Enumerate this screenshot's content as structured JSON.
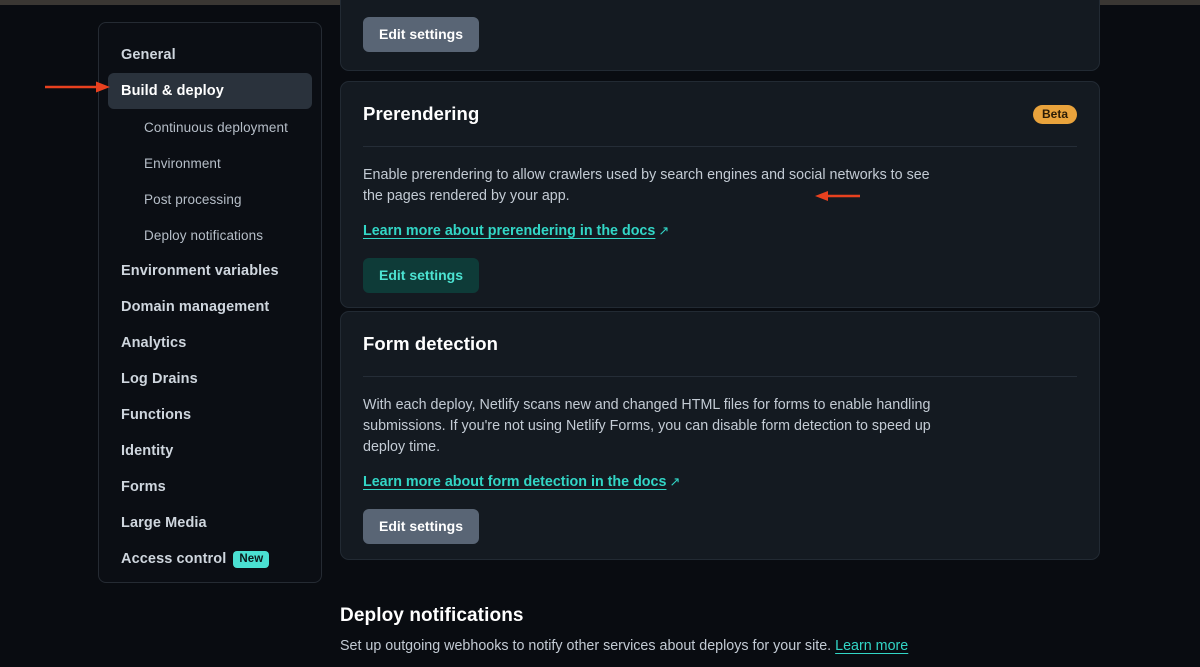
{
  "sidebar": {
    "items": [
      {
        "label": "General",
        "level": "top",
        "active": false
      },
      {
        "label": "Build & deploy",
        "level": "top",
        "active": true
      },
      {
        "label": "Continuous deployment",
        "level": "sub",
        "active": false
      },
      {
        "label": "Environment",
        "level": "sub",
        "active": false
      },
      {
        "label": "Post processing",
        "level": "sub",
        "active": false
      },
      {
        "label": "Deploy notifications",
        "level": "sub",
        "active": false
      },
      {
        "label": "Environment variables",
        "level": "top",
        "active": false
      },
      {
        "label": "Domain management",
        "level": "top",
        "active": false
      },
      {
        "label": "Analytics",
        "level": "top",
        "active": false
      },
      {
        "label": "Log Drains",
        "level": "top",
        "active": false
      },
      {
        "label": "Functions",
        "level": "top",
        "active": false
      },
      {
        "label": "Identity",
        "level": "top",
        "active": false
      },
      {
        "label": "Forms",
        "level": "top",
        "active": false
      },
      {
        "label": "Large Media",
        "level": "top",
        "active": false
      },
      {
        "label": "Access control",
        "level": "top",
        "active": false,
        "badge": "New"
      }
    ]
  },
  "cards": {
    "top_partial": {
      "button_label": "Edit settings"
    },
    "prerendering": {
      "title": "Prerendering",
      "badge": "Beta",
      "description": "Enable prerendering to allow crawlers used by search engines and social networks to see the pages rendered by your app.",
      "link_label": "Learn more about prerendering in the docs",
      "link_icon": "external-link-arrow",
      "button_label": "Edit settings"
    },
    "form_detection": {
      "title": "Form detection",
      "description": "With each deploy, Netlify scans new and changed HTML files for forms to enable handling submissions. If you're not using Netlify Forms, you can disable form detection to speed up deploy time.",
      "link_label": "Learn more about form detection in the docs",
      "link_icon": "external-link-arrow",
      "button_label": "Edit settings"
    }
  },
  "bottom_section": {
    "title": "Deploy notifications",
    "description": "Set up outgoing webhooks to notify other services about deploys for your site.",
    "link_label": "Learn more"
  },
  "annotations": [
    {
      "name": "arrow-to-build-and-deploy",
      "direction": "right",
      "color": "#e8411f"
    },
    {
      "name": "arrow-to-prerendering",
      "direction": "left",
      "color": "#e8411f"
    }
  ],
  "colors": {
    "page_background": "#090c11",
    "card_background": "#141a21",
    "sidebar_background": "#0b0e14",
    "active_nav_background": "#2a323c",
    "link_teal": "#32d6c6",
    "badge_new_background": "#4ae0d2",
    "badge_beta_background": "#e9a33c",
    "button_grey": "#596575",
    "button_teal_background": "#0e3b38",
    "annotation_red": "#e8411f"
  }
}
